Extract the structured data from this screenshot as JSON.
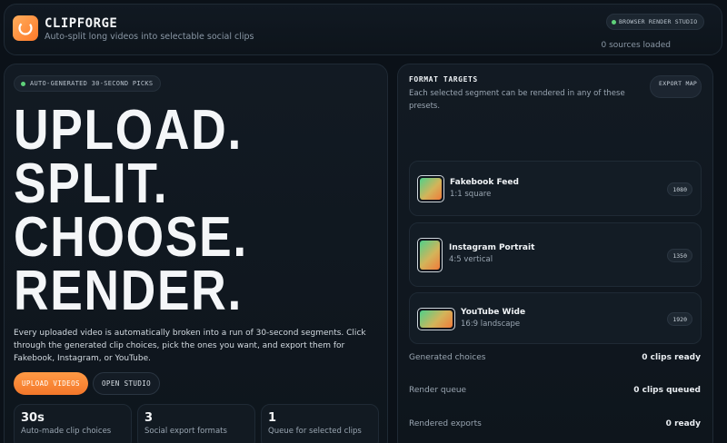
{
  "header": {
    "brand": "CLIPFORGE",
    "tagline": "Auto-split long videos into selectable social clips",
    "studio_badge": "BROWSER RENDER STUDIO",
    "sources": "0 sources loaded"
  },
  "hero": {
    "pill": "AUTO-GENERATED 30-SECOND PICKS",
    "lines": [
      "UPLOAD.",
      "SPLIT.",
      "CHOOSE.",
      "RENDER."
    ],
    "description": "Every uploaded video is automatically broken into a run of 30-second segments. Click through the generated clip choices, pick the ones you want, and export them for Fakebook, Instagram, or YouTube.",
    "upload_button": "UPLOAD VIDEOS",
    "open_button": "OPEN STUDIO",
    "stats": [
      {
        "value": "30s",
        "label": "Auto-made clip choices"
      },
      {
        "value": "3",
        "label": "Social export formats"
      },
      {
        "value": "1",
        "label": "Queue for selected clips"
      }
    ]
  },
  "formats": {
    "title": "FORMAT TARGETS",
    "subtitle": "Each selected segment can be rendered in any of these presets.",
    "export_map": "EXPORT MAP",
    "cards": [
      {
        "title": "Fakebook Feed",
        "subtitle": "1:1 square",
        "count": "1080"
      },
      {
        "title": "Instagram Portrait",
        "subtitle": "4:5 vertical",
        "count": "1350"
      },
      {
        "title": "YouTube Wide",
        "subtitle": "16:9 landscape",
        "count": "1920"
      }
    ],
    "summary": [
      {
        "label": "Generated choices",
        "value": "0 clips ready"
      },
      {
        "label": "Render queue",
        "value": "0 clips queued"
      },
      {
        "label": "Rendered exports",
        "value": "0 ready"
      }
    ]
  },
  "colors": {
    "accent": "#ff8a3a",
    "status_dot": "#5fd27a",
    "background": "#0b1118"
  }
}
